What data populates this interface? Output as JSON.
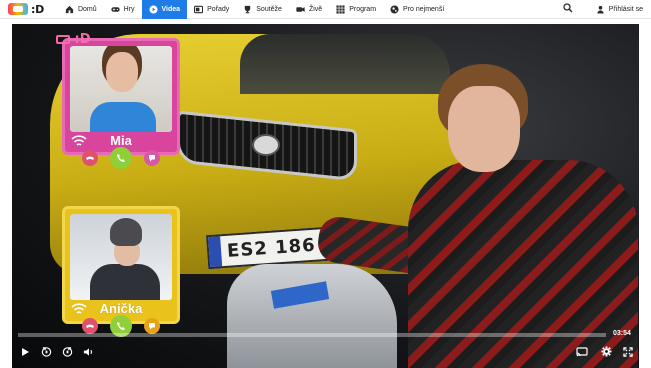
{
  "nav": {
    "logo_text": ":D",
    "items": [
      {
        "label": "Domů",
        "icon": "home-icon",
        "active": false
      },
      {
        "label": "Hry",
        "icon": "gamepad-icon",
        "active": false
      },
      {
        "label": "Videa",
        "icon": "play-circle-icon",
        "active": true
      },
      {
        "label": "Pořady",
        "icon": "tv-icon",
        "active": false
      },
      {
        "label": "Soutěže",
        "icon": "trophy-icon",
        "active": false
      },
      {
        "label": "Živě",
        "icon": "live-camera-icon",
        "active": false
      },
      {
        "label": "Program",
        "icon": "grid-icon",
        "active": false
      },
      {
        "label": "Pro nejmenší",
        "icon": "globe-icon",
        "active": false
      }
    ],
    "search_icon": "search-icon",
    "login_label": "Přihlásit se",
    "accent_color": "#1f7ce6"
  },
  "video": {
    "watermark": ":D",
    "plate_text": "ES2 186",
    "callers": [
      {
        "name": "Mia",
        "color": "#d9459c"
      },
      {
        "name": "Anička",
        "color": "#e9c21c"
      }
    ],
    "controls": {
      "duration": "03:54",
      "progress_fraction": 0.0,
      "play_icon": "play-icon",
      "rewind_icon": "rewind-10-icon",
      "forward_icon": "forward-10-icon",
      "volume_icon": "volume-icon",
      "cast_icon": "cast-icon",
      "settings_icon": "gear-icon",
      "fullscreen_icon": "fullscreen-icon"
    }
  }
}
